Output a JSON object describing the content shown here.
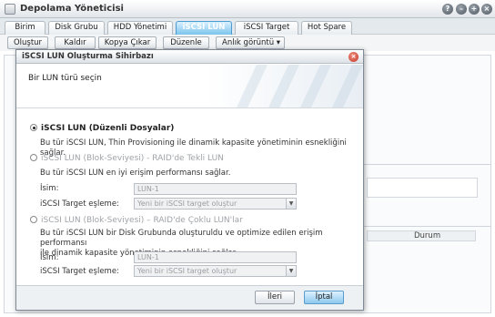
{
  "window": {
    "title": "Depolama Yöneticisi",
    "controls": {
      "help": "?",
      "minimize": "–",
      "maximize": "+",
      "close": "×"
    }
  },
  "tabs": [
    {
      "label": "Birim"
    },
    {
      "label": "Disk Grubu"
    },
    {
      "label": "HDD Yönetimi"
    },
    {
      "label": "iSCSI LUN",
      "active": true
    },
    {
      "label": "iSCSI Target"
    },
    {
      "label": "Hot Spare"
    }
  ],
  "toolbar": {
    "create": "Oluştur",
    "remove": "Kaldır",
    "clone": "Kopya Çıkar",
    "edit": "Düzenle",
    "snapshot": "Anlık görüntü",
    "snapshot_arrow": "▾"
  },
  "background": {
    "column_status": "Durum"
  },
  "dialog": {
    "title": "iSCSI LUN Oluşturma Sihirbazı",
    "close": "×",
    "heading": "Bir LUN türü seçin",
    "options": [
      {
        "title": "iSCSI LUN (Düzenli Dosyalar)",
        "selected": true,
        "enabled": true,
        "description": "Bu tür iSCSI LUN, Thin Provisioning ile dinamik kapasite yönetiminin esnekliğini sağlar."
      },
      {
        "title": "iSCSI LUN (Blok-Seviyesi) - RAID'de Tekli LUN",
        "selected": false,
        "enabled": false,
        "description": "Bu tür iSCSI LUN en iyi erişim performansı sağlar.",
        "name_label": "İsim:",
        "name_value": "LUN-1",
        "target_label": "iSCSI Target eşleme:",
        "target_value": "Yeni bir iSCSI target oluştur"
      },
      {
        "title": "iSCSI LUN (Blok-Seviyesi) – RAID'de Çoklu LUN'lar",
        "selected": false,
        "enabled": false,
        "description_line1": "Bu tür iSCSI LUN bir Disk Grubunda oluşturuldu ve optimize edilen erişim performansı",
        "description_line2": "ile dinamik kapasite yönetiminin esnekliğini sağlar.",
        "name_label": "İsim:",
        "name_value": "LUN-1",
        "target_label": "iSCSI Target eşleme:",
        "target_value": "Yeni bir iSCSI target oluştur"
      }
    ],
    "next_button": "İleri",
    "cancel_button": "İptal"
  }
}
